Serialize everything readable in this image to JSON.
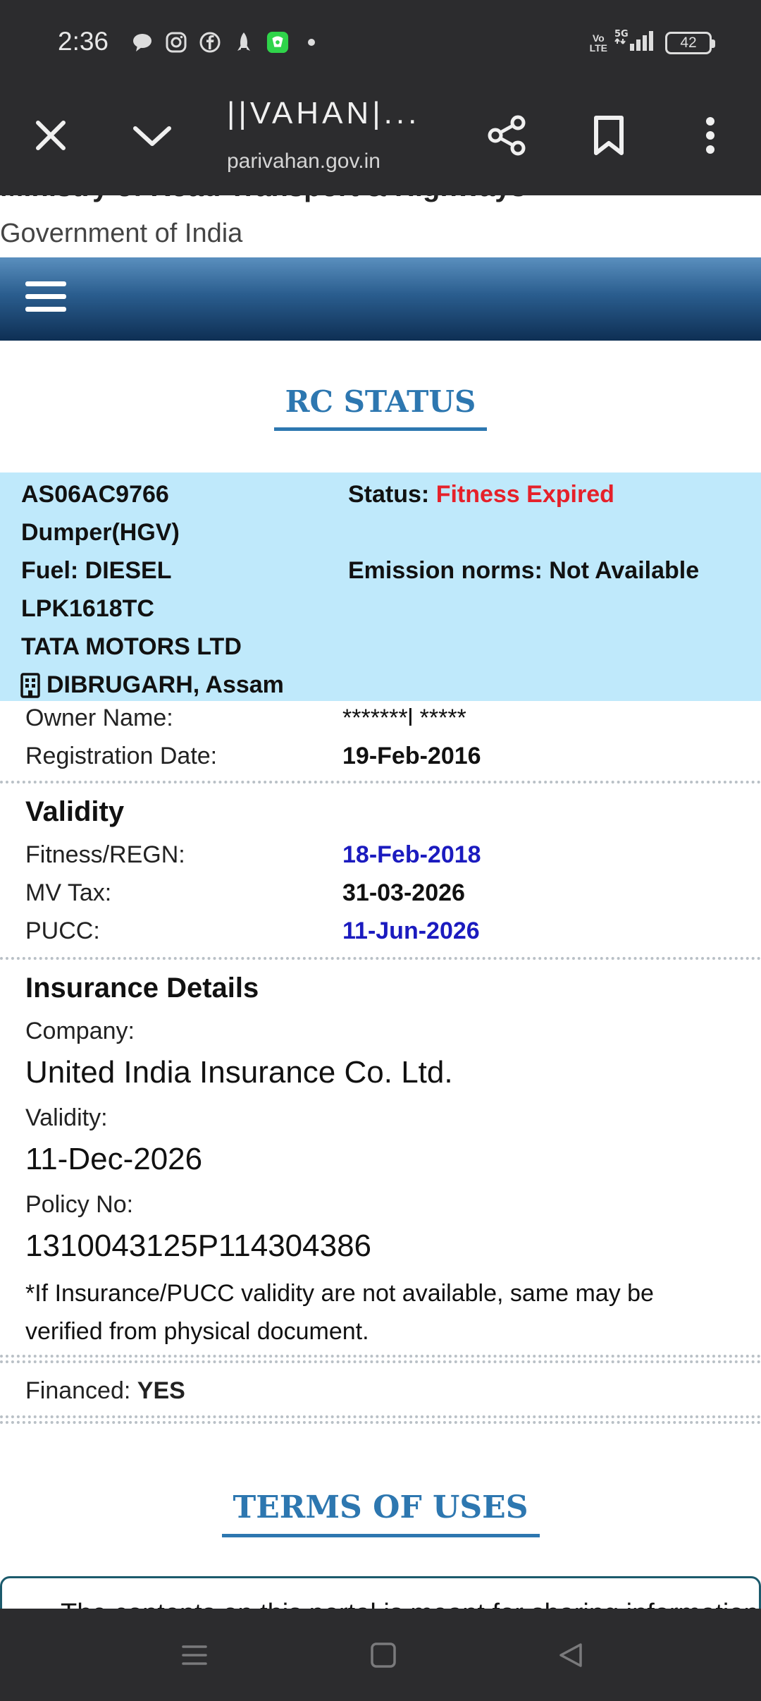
{
  "status_bar": {
    "time": "2:36",
    "notification_icons": [
      "chat-icon",
      "instagram-icon",
      "facebook-icon",
      "rocket-icon",
      "app-icon",
      "dot-icon"
    ],
    "network": "5G",
    "battery": "42"
  },
  "browser": {
    "title": "||VAHAN|...",
    "url": "parivahan.gov.in"
  },
  "header": {
    "ministry": "Ministry of Road Transport & Highways",
    "government": "Government of India"
  },
  "rc": {
    "section_title": "RC STATUS",
    "reg_no": "AS06AC9766",
    "vehicle_class": "Dumper(HGV)",
    "fuel": "Fuel: DIESEL",
    "model": "LPK1618TC",
    "maker": "TATA MOTORS LTD",
    "location": "DIBRUGARH, Assam",
    "status_label": "Status:",
    "status_value": "Fitness Expired",
    "emission": "Emission norms: Not Available"
  },
  "owner": {
    "owner_label": "Owner Name:",
    "owner_value": "*******l *****",
    "reg_date_label": "Registration Date:",
    "reg_date_value": "19-Feb-2016"
  },
  "validity": {
    "heading": "Validity",
    "fitness_label": "Fitness/REGN:",
    "fitness_value": "18-Feb-2018",
    "tax_label": "MV Tax:",
    "tax_value": "31-03-2026",
    "pucc_label": "PUCC:",
    "pucc_value": "11-Jun-2026"
  },
  "insurance": {
    "heading": "Insurance Details",
    "company_label": "Company:",
    "company_value": "United India Insurance Co. Ltd.",
    "validity_label": "Validity:",
    "validity_value": "11-Dec-2026",
    "policy_label": "Policy No:",
    "policy_value": "1310043125P114304386",
    "note": "*If Insurance/PUCC validity are not available, same may be verified from physical document."
  },
  "finance": {
    "label": "Financed:",
    "value": "YES"
  },
  "terms": {
    "title": "TERMS OF USES",
    "text": "The contents on this portal is meant for sharing information"
  },
  "colors": {
    "status_expired": "#e5212a",
    "date_blue": "#1b1bbf",
    "section_title": "#2d77b0",
    "rc_panel_bg": "#bfe9fb"
  }
}
